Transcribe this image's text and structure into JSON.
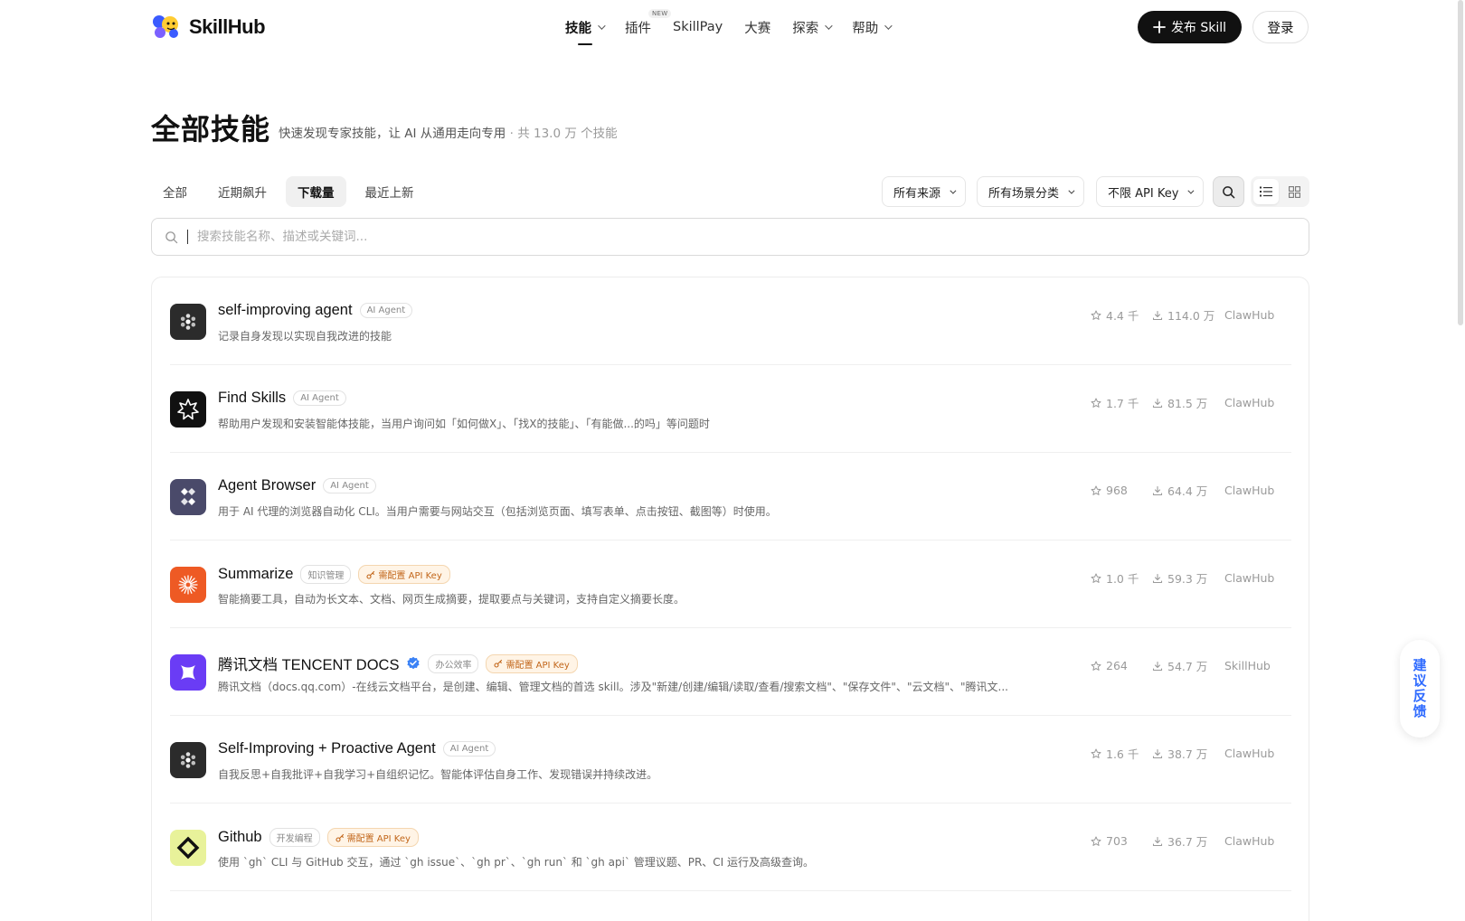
{
  "header": {
    "brand": "SkillHub",
    "nav": [
      {
        "label": "技能",
        "active": true,
        "dropdown": true
      },
      {
        "label": "插件",
        "badge": "NEW"
      },
      {
        "label": "SkillPay"
      },
      {
        "label": "大赛"
      },
      {
        "label": "探索",
        "dropdown": true
      },
      {
        "label": "帮助",
        "dropdown": true
      }
    ],
    "publish_label": "发布 Skill",
    "login_label": "登录"
  },
  "page": {
    "title": "全部技能",
    "subtitle": "快速发现专家技能，让 AI 从通用走向专用",
    "count": "· 共 13.0 万 个技能"
  },
  "tabs": [
    "全部",
    "近期飙升",
    "下载量",
    "最近上新"
  ],
  "active_tab": "下载量",
  "filters": {
    "source": "所有来源",
    "category": "所有场景分类",
    "api_key": "不限 API Key"
  },
  "search": {
    "placeholder": "搜索技能名称、描述或关键词..."
  },
  "skills": [
    {
      "name": "self-improving agent",
      "tags": [
        "AI Agent"
      ],
      "needs_key": false,
      "desc": "记录自身发现以实现自我改进的技能",
      "stars": "4.4 千",
      "downloads": "114.0 万",
      "source": "ClawHub",
      "icon": "flower-icon",
      "icon_bg": "#2b2b2b"
    },
    {
      "name": "Find Skills",
      "tags": [
        "AI Agent"
      ],
      "needs_key": false,
      "desc": "帮助用户发现和安装智能体技能，当用户询问如「如何做X」、「找X的技能」、「有能做...的吗」等问题时",
      "stars": "1.7 千",
      "downloads": "81.5 万",
      "source": "ClawHub",
      "icon": "starburst-icon",
      "icon_bg": "#111111"
    },
    {
      "name": "Agent Browser",
      "tags": [
        "AI Agent"
      ],
      "needs_key": false,
      "desc": "用于 AI 代理的浏览器自动化 CLI。当用户需要与网站交互（包括浏览页面、填写表单、点击按钮、截图等）时使用。",
      "stars": "968",
      "downloads": "64.4 万",
      "source": "ClawHub",
      "icon": "diamonds-icon",
      "icon_bg": "#4a4a6a"
    },
    {
      "name": "Summarize",
      "tags": [
        "知识管理"
      ],
      "needs_key": true,
      "desc": "智能摘要工具，自动为长文本、文档、网页生成摘要，提取要点与关键词，支持自定义摘要长度。",
      "stars": "1.0 千",
      "downloads": "59.3 万",
      "source": "ClawHub",
      "icon": "sunburst-icon",
      "icon_bg": "#ee5a24"
    },
    {
      "name": "腾讯文档 TENCENT DOCS",
      "tags": [
        "办公效率"
      ],
      "needs_key": true,
      "verified": true,
      "desc": "腾讯文档（docs.qq.com）-在线云文档平台，是创建、编辑、管理文档的首选 skill。涉及\"新建/创建/编辑/读取/查看/搜索文档\"、\"保存文件\"、\"云文档\"、\"腾讯文...",
      "stars": "264",
      "downloads": "54.7 万",
      "source": "SkillHub",
      "icon": "tencent-docs-icon",
      "icon_bg": "#6a3cf5"
    },
    {
      "name": "Self-Improving + Proactive Agent",
      "tags": [
        "AI Agent"
      ],
      "needs_key": false,
      "desc": "自我反思+自我批评+自我学习+自组织记忆。智能体评估自身工作、发现错误并持续改进。",
      "stars": "1.6 千",
      "downloads": "38.7 万",
      "source": "ClawHub",
      "icon": "flower-icon",
      "icon_bg": "#2b2b2b"
    },
    {
      "name": "Github",
      "tags": [
        "开发编程"
      ],
      "needs_key": true,
      "desc": "使用 `gh` CLI 与 GitHub 交互，通过 `gh issue`、`gh pr`、`gh run` 和 `gh api` 管理议题、PR、CI 运行及高级查询。",
      "stars": "703",
      "downloads": "36.7 万",
      "source": "ClawHub",
      "icon": "diamond-outline-icon",
      "icon_bg": "#e8f29a"
    }
  ],
  "key_tag_label": "需配置 API Key",
  "feedback_label": "建议反馈"
}
